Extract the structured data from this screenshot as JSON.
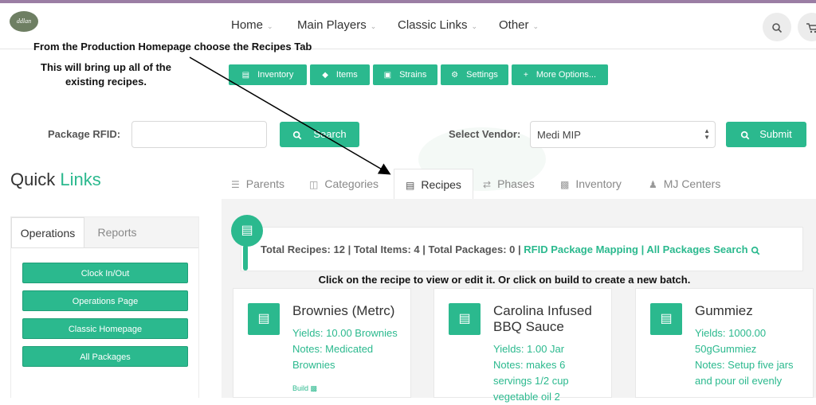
{
  "header": {
    "nav": [
      "Home",
      "Main Players",
      "Classic Links",
      "Other"
    ],
    "search_icon": "search-icon",
    "cart_icon": "cart-icon"
  },
  "annotations": {
    "line1": "From the Production Homepage choose the Recipes Tab",
    "line2": "This will bring up all of the",
    "line3": "existing recipes.",
    "line4": "Click on the recipe to view or edit it. Or click on build to create a new batch."
  },
  "options": [
    {
      "label": "Inventory",
      "icon": "cubes-icon"
    },
    {
      "label": "Items",
      "icon": "cube-icon"
    },
    {
      "label": "Strains",
      "icon": "briefcase-icon"
    },
    {
      "label": "Settings",
      "icon": "gear-icon"
    },
    {
      "label": "More Options...",
      "icon": "plus-icon"
    }
  ],
  "rfid": {
    "label": "Package RFID:",
    "value": "",
    "search_label": "Search"
  },
  "vendor": {
    "label": "Select Vendor:",
    "selected": "Medi MIP",
    "submit_label": "Submit"
  },
  "quick_links": {
    "title_a": "Quick ",
    "title_b": "Links",
    "tabs": [
      "Operations",
      "Reports"
    ],
    "buttons": [
      "Clock In/Out",
      "Operations Page",
      "Classic Homepage",
      "All Packages"
    ]
  },
  "tabs": [
    {
      "label": "Parents",
      "icon": "list-icon"
    },
    {
      "label": "Categories",
      "icon": "sitemap-icon"
    },
    {
      "label": "Recipes",
      "icon": "recipe-icon"
    },
    {
      "label": "Phases",
      "icon": "shuffle-icon"
    },
    {
      "label": "Inventory",
      "icon": "cubes-icon"
    },
    {
      "label": "MJ Centers",
      "icon": "user-icon"
    }
  ],
  "summary": {
    "totals": "Total Recipes: 12 | Total Items: 4 | Total Packages: 0 | ",
    "link1": "RFID Package Mapping",
    "sep": " | ",
    "link2": "All Packages Search"
  },
  "recipes": [
    {
      "title": "Brownies (Metrc)",
      "lines": [
        "Yields: 10.00 Brownies",
        "Notes: Medicated",
        "Brownies"
      ],
      "build": "Build"
    },
    {
      "title": "Carolina Infused BBQ Sauce",
      "lines": [
        "Yields: 1.00 Jar",
        "Notes: makes 6",
        "servings 1/2 cup",
        "vegetable oil 2"
      ]
    },
    {
      "title": "Gummiez",
      "lines": [
        "Yields: 1000.00",
        "50gGummiez",
        "Notes: Setup five jars",
        "and pour oil evenly"
      ]
    }
  ],
  "colors": {
    "accent": "#2bb98e",
    "topstrip": "#9b7ea4"
  }
}
